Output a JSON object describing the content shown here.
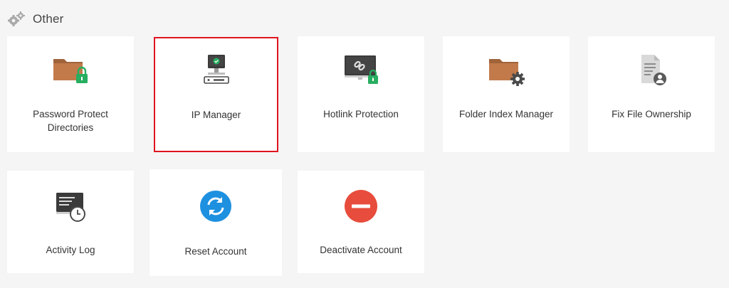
{
  "section": {
    "title": "Other",
    "icon": "gears-icon"
  },
  "accent_colors": {
    "folder": "#c27a4b",
    "lock": "#27ae60",
    "refresh": "#1e90e0",
    "deactivate": "#e74c3c",
    "selection_outline": "#e0141e"
  },
  "cards": [
    {
      "label": "Password Protect Directories",
      "icon": "folder-lock-icon"
    },
    {
      "label": "IP Manager",
      "icon": "ip-manager-icon",
      "selected": true
    },
    {
      "label": "Hotlink Protection",
      "icon": "hotlink-lock-icon"
    },
    {
      "label": "Folder Index Manager",
      "icon": "folder-gear-icon"
    },
    {
      "label": "Fix File Ownership",
      "icon": "file-user-icon"
    },
    {
      "label": "Activity Log",
      "icon": "log-clock-icon"
    },
    {
      "label": "Reset Account",
      "icon": "refresh-icon"
    },
    {
      "label": "Deactivate Account",
      "icon": "deactivate-icon"
    }
  ]
}
